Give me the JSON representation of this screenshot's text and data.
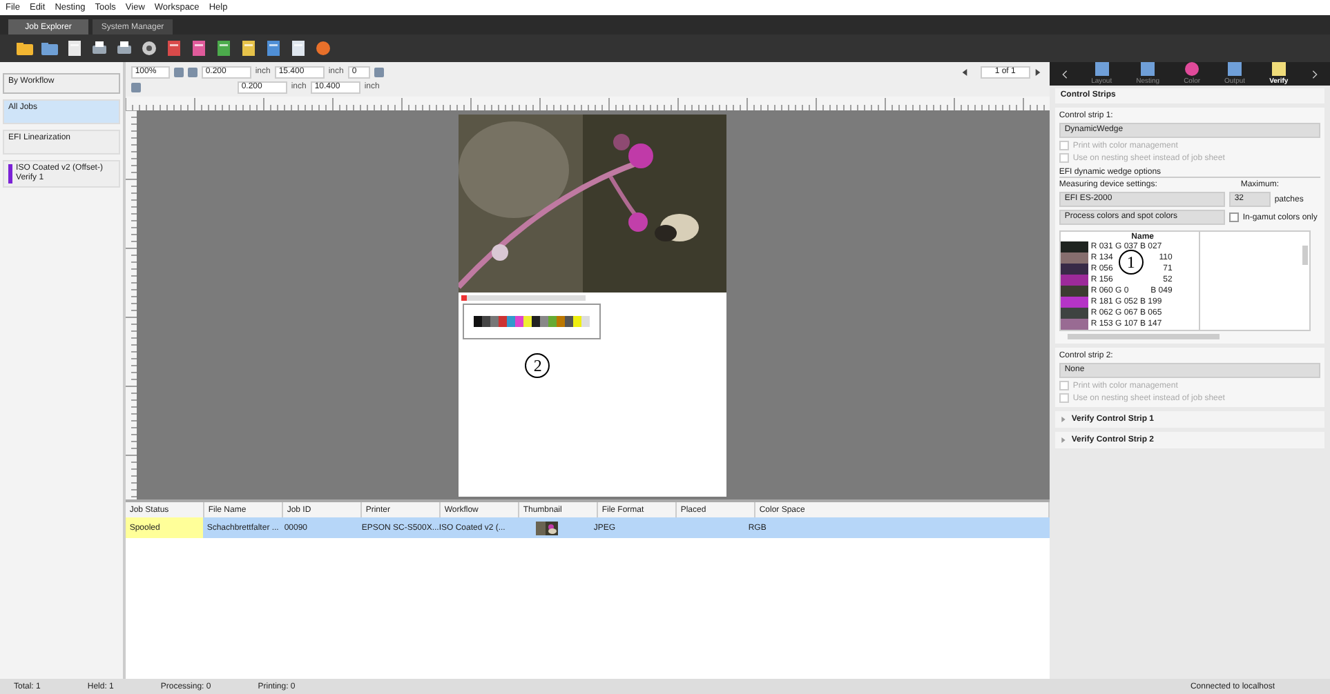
{
  "menu": [
    "File",
    "Edit",
    "Nesting",
    "Tools",
    "View",
    "Workspace",
    "Help"
  ],
  "tabs": [
    {
      "label": "Job Explorer",
      "selected": true
    },
    {
      "label": "System Manager",
      "selected": false
    }
  ],
  "sidebar": {
    "filter": "By Workflow",
    "items": [
      {
        "label": "All Jobs",
        "selected": true
      },
      {
        "label": "EFI Linearization",
        "selected": false
      },
      {
        "label": "ISO Coated v2 (Offset-) Verify 1",
        "selected": false,
        "color": "#7b22d6"
      }
    ]
  },
  "layout_toolbar": {
    "zoom": "100%",
    "fields": [
      {
        "value": "0.200",
        "unit": "inch"
      },
      {
        "value": "15.400",
        "unit": "inch"
      },
      {
        "value": "0.200",
        "unit": "inch"
      },
      {
        "value": "10.400",
        "unit": "inch"
      }
    ],
    "rotation": "0"
  },
  "pager": "1 of 1",
  "page": {
    "annotation": "2"
  },
  "job_table": {
    "columns": [
      "Job Status",
      "File Name",
      "Job ID",
      "Printer",
      "Workflow",
      "Thumbnail",
      "File Format",
      "Placed",
      "Color Space"
    ],
    "rows": [
      {
        "selected": true,
        "cells": [
          {
            "kind": "text",
            "text": "Spooled",
            "color": "#ffff99"
          },
          {
            "kind": "text",
            "text": "Schachbrettfalter ..."
          },
          {
            "kind": "text",
            "text": "00090"
          },
          {
            "kind": "text",
            "text": "EPSON SC-S500X..."
          },
          {
            "kind": "text",
            "text": "ISO Coated v2 (..."
          },
          {
            "kind": "picture"
          },
          {
            "kind": "text",
            "text": "JPEG"
          },
          {
            "kind": "blank"
          },
          {
            "kind": "text",
            "text": "RGB"
          }
        ]
      }
    ]
  },
  "status_bar": {
    "counts": [
      "Total: 1",
      "Held: 1",
      "Processing: 0",
      "Printing: 0"
    ],
    "connection": "Connected to localhost"
  },
  "right_panel": {
    "tabs": [
      {
        "label": "Layout",
        "selected": false
      },
      {
        "label": "Nesting",
        "selected": false
      },
      {
        "label": "Color",
        "selected": false
      },
      {
        "label": "Output",
        "selected": false
      },
      {
        "label": "Verify",
        "selected": true
      }
    ],
    "section": "Control Strips",
    "strip1": {
      "label": "Control strip 1:",
      "value": "DynamicWedge",
      "options": [
        {
          "label": "Print with color management",
          "checked": false,
          "disabled": true
        },
        {
          "label": "Use on nesting sheet instead of job sheet",
          "checked": false,
          "disabled": true
        }
      ]
    },
    "wedge": {
      "title": "EFI dynamic wedge options",
      "device_label": "Measuring device settings:",
      "device": "EFI ES-2000",
      "max_label": "Maximum:",
      "max": "32",
      "max_unit": "patches",
      "colors": "Process colors and spot colors",
      "gamut": {
        "label": "In-gamut colors only",
        "checked": false
      }
    },
    "patch_table": {
      "header": "Name",
      "annotation": "1",
      "rows": [
        {
          "color": "#1f2420",
          "name": "R 031 G 037 B 027"
        },
        {
          "color": "#866e6e",
          "name": "R 134",
          "tail": "110"
        },
        {
          "color": "#382a47",
          "name": "R 056",
          "tail": "71"
        },
        {
          "color": "#9c2a99",
          "name": "R 156",
          "tail": "52"
        },
        {
          "color": "#3c3c31",
          "name": "R 060 G 0",
          "tail": "B 049"
        },
        {
          "color": "#b534c7",
          "name": "R 181 G 052 B 199"
        },
        {
          "color": "#3e4341",
          "name": "R 062 G 067 B 065"
        },
        {
          "color": "#996b93",
          "name": "R 153 G 107 B 147"
        }
      ]
    },
    "strip2": {
      "label": "Control strip 2:",
      "value": "None",
      "options": [
        {
          "label": "Print with color management",
          "checked": false,
          "disabled": true
        },
        {
          "label": "Use on nesting sheet instead of job sheet",
          "checked": false,
          "disabled": true
        }
      ]
    },
    "sections": [
      {
        "label": "Verify Control Strip 1",
        "expanded": false
      },
      {
        "label": "Verify Control Strip 2",
        "expanded": false
      }
    ]
  }
}
